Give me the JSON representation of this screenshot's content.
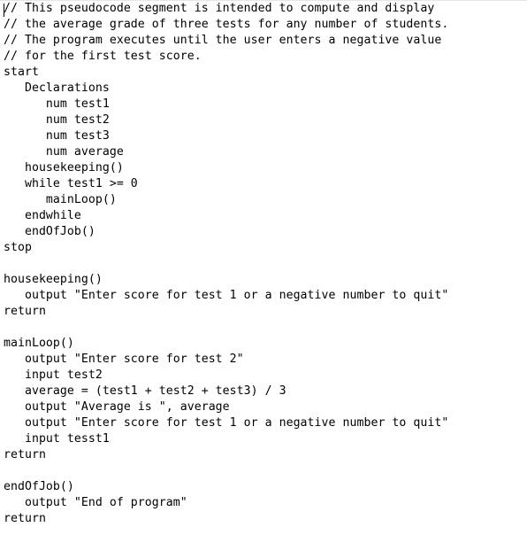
{
  "document": {
    "lines": [
      "// This pseudocode segment is intended to compute and display",
      "// the average grade of three tests for any number of students.",
      "// The program executes until the user enters a negative value",
      "// for the first test score.",
      "start",
      "   Declarations",
      "      num test1",
      "      num test2",
      "      num test3",
      "      num average",
      "   housekeeping()",
      "   while test1 >= 0",
      "      mainLoop()",
      "   endwhile",
      "   endOfJob()",
      "stop",
      "",
      "housekeeping()",
      "   output \"Enter score for test 1 or a negative number to quit\"",
      "return",
      "",
      "mainLoop()",
      "   output \"Enter score for test 2\"",
      "   input test2",
      "   average = (test1 + test2 + test3) / 3",
      "   output \"Average is \", average",
      "   output \"Enter score for test 1 or a negative number to quit\"",
      "   input tesst1",
      "return",
      "",
      "endOfJob()",
      "   output \"End of program\"",
      "return"
    ]
  }
}
